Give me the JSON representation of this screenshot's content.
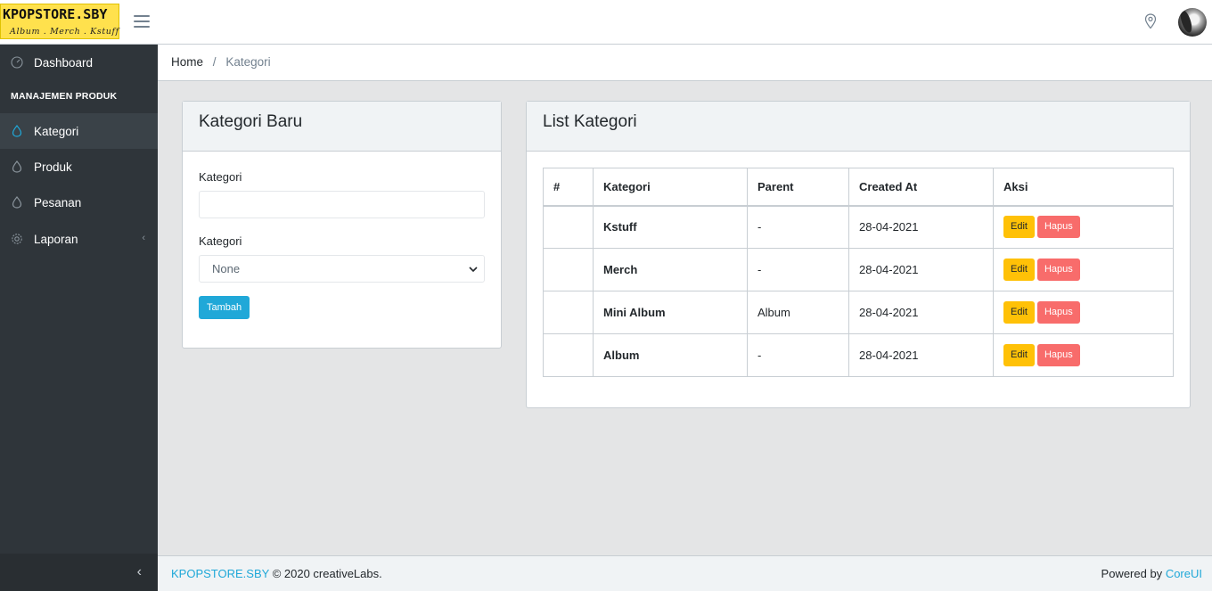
{
  "header": {
    "logo_title": "KPOPSTORE.SBY",
    "logo_subtitle": "Album . Merch . Kstuff"
  },
  "sidebar": {
    "items": [
      {
        "label": "Dashboard",
        "icon": "speedometer-icon"
      },
      {
        "label": "Kategori",
        "icon": "drop-icon",
        "active": true
      },
      {
        "label": "Produk",
        "icon": "drop-icon"
      },
      {
        "label": "Pesanan",
        "icon": "drop-icon"
      },
      {
        "label": "Laporan",
        "icon": "settings-icon",
        "caret": "‹"
      }
    ],
    "section_title": "MANAJEMEN PRODUK",
    "minimizer": "‹"
  },
  "breadcrumb": {
    "home": "Home",
    "separator": "/",
    "current": "Kategori"
  },
  "form_card": {
    "title": "Kategori Baru",
    "field1_label": "Kategori",
    "field1_value": "",
    "field2_label": "Kategori",
    "field2_selected": "None",
    "submit_label": "Tambah"
  },
  "list_card": {
    "title": "List Kategori",
    "columns": [
      "#",
      "Kategori",
      "Parent",
      "Created At",
      "Aksi"
    ],
    "rows": [
      {
        "num": "",
        "kategori": "Kstuff",
        "parent": "-",
        "created_at": "28-04-2021"
      },
      {
        "num": "",
        "kategori": "Merch",
        "parent": "-",
        "created_at": "28-04-2021"
      },
      {
        "num": "",
        "kategori": "Mini Album",
        "parent": "Album",
        "created_at": "28-04-2021"
      },
      {
        "num": "",
        "kategori": "Album",
        "parent": "-",
        "created_at": "28-04-2021"
      }
    ],
    "edit_label": "Edit",
    "delete_label": "Hapus"
  },
  "footer": {
    "brand_link": "KPOPSTORE.SBY",
    "copyright": "© 2020 creativeLabs.",
    "powered_by": "Powered by",
    "framework_link": "CoreUI"
  },
  "colors": {
    "sidebar_bg": "#2f353a",
    "primary": "#20a8d8",
    "warning": "#ffc107",
    "danger": "#f86c6b",
    "logo_bg": "#ffe14d"
  }
}
